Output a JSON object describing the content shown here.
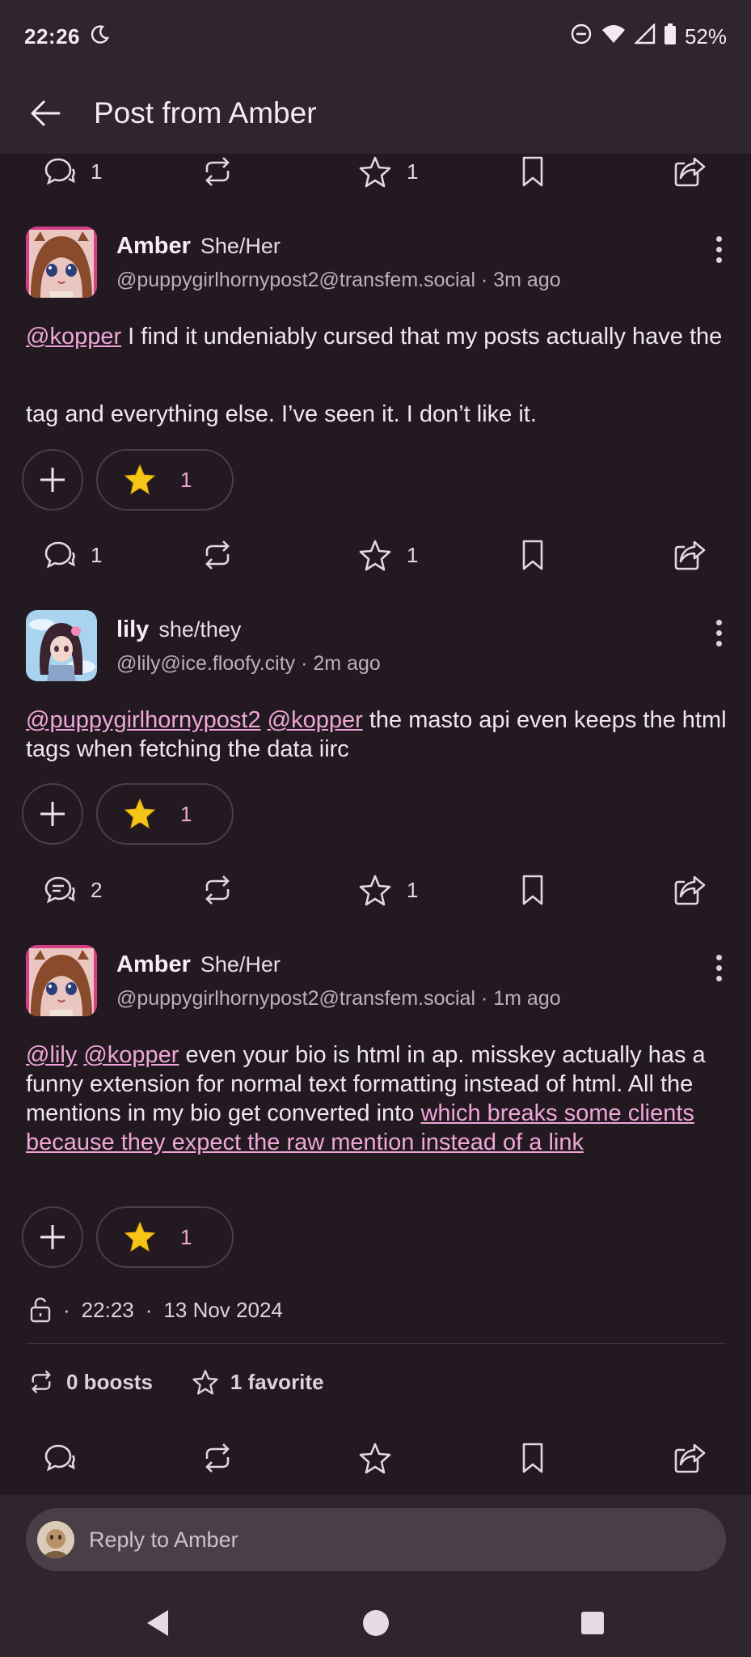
{
  "status": {
    "time": "22:26",
    "battery": "52%"
  },
  "appbar": {
    "title": "Post from Amber"
  },
  "top_actions": {
    "replies": "1",
    "favorites": "1"
  },
  "posts": [
    {
      "name": "Amber",
      "pronouns": "She/Her",
      "handle": "@puppygirlhornypost2@transfem.social · 3m ago",
      "mention1": "@kopper",
      "text1": " I find it undeniably cursed that my posts actually have the",
      "text2": " tag and everything else. I’ve seen it. I don’t like it.",
      "reaction_count": "1",
      "replies": "1",
      "favorites": "1"
    },
    {
      "name": "lily",
      "pronouns": "she/they",
      "handle": "@lily@ice.floofy.city · 2m ago",
      "mention1": "@puppygirlhornypost2",
      "mention2": "@kopper",
      "text1": " the masto api even keeps the html tags when fetching the data iirc",
      "reaction_count": "1",
      "replies": "2",
      "favorites": "1"
    },
    {
      "name": "Amber",
      "pronouns": "She/Her",
      "handle": "@puppygirlhornypost2@transfem.social · 1m ago",
      "mention1": "@lily",
      "mention2": "@kopper",
      "text1": " even your bio is html in ap. misskey actually has a funny extension for normal text formatting instead of html. All the mentions in my bio get converted into ",
      "link": " which breaks some clients because they expect the raw mention instead of a link",
      "reaction_count": "1",
      "meta_time": "22:23",
      "meta_date": "13 Nov 2024",
      "boosts": "0 boosts",
      "favorites_summary": "1 favorite"
    }
  ],
  "reply": {
    "placeholder": "Reply to Amber"
  },
  "colors": {
    "background": "#231a21",
    "bar": "#2f252d",
    "accent": "#f0a6d8",
    "star": "#f5c518"
  }
}
